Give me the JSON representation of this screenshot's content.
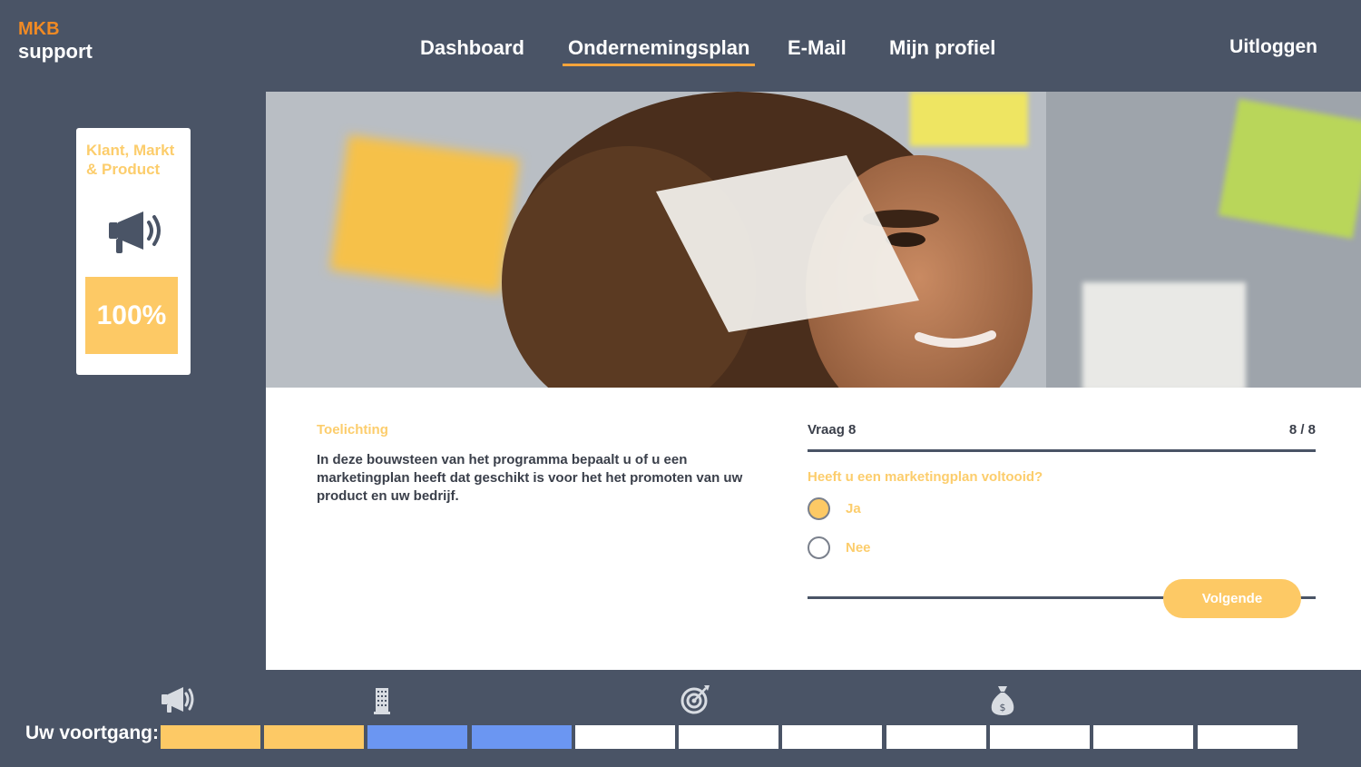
{
  "brand": {
    "line1": "MKB",
    "line2": "support"
  },
  "nav": {
    "items": [
      {
        "label": "Dashboard",
        "active": false
      },
      {
        "label": "Ondernemingsplan",
        "active": true
      },
      {
        "label": "E-Mail",
        "active": false
      },
      {
        "label": "Mijn profiel",
        "active": false
      }
    ],
    "logout": "Uitloggen"
  },
  "side_card": {
    "title": "Klant, Markt & Product",
    "icon": "megaphone-icon",
    "progress_text": "100%",
    "progress_fraction": 1.0
  },
  "explanation": {
    "heading": "Toelichting",
    "text": "In deze bouwsteen van het programma bepaalt u of u een marketingplan heeft dat geschikt is voor het het promoten van uw product en uw bedrijf."
  },
  "question": {
    "label": "Vraag 8",
    "counter": "8 / 8",
    "text": "Heeft u een marketingplan voltooid?",
    "options": [
      {
        "label": "Ja",
        "selected": true
      },
      {
        "label": "Nee",
        "selected": false
      }
    ],
    "next_button": "Volgende"
  },
  "progress": {
    "label": "Uw voortgang:",
    "icons": [
      "megaphone-icon",
      "building-icon",
      "target-icon",
      "money-bag-icon"
    ],
    "segments": [
      "complete",
      "complete",
      "in-progress",
      "in-progress",
      "empty",
      "empty",
      "empty",
      "empty",
      "empty",
      "empty",
      "empty"
    ]
  },
  "colors": {
    "background": "#4a5466",
    "accent_orange": "#f08a24",
    "accent_yellow": "#fdc965",
    "segment_blue": "#6b96f2",
    "segment_empty": "#ffffff"
  }
}
